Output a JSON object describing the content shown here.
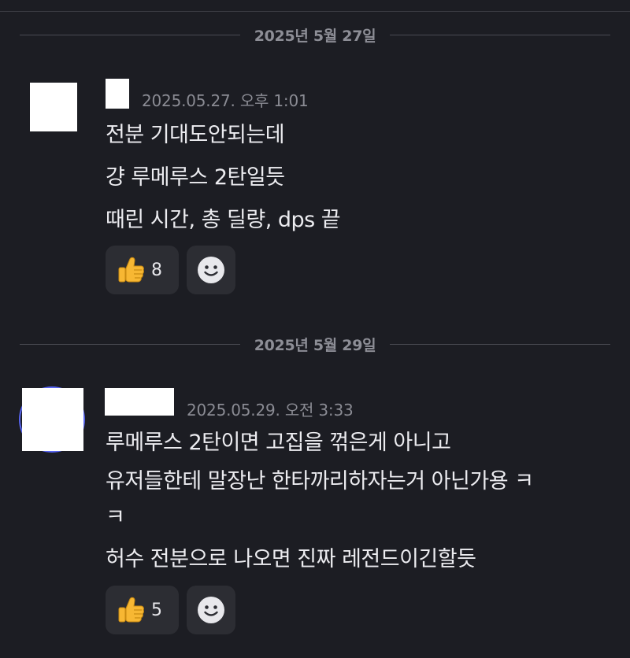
{
  "dividers": [
    {
      "text": "2025년 5월 27일"
    },
    {
      "text": "2025년 5월 29일"
    }
  ],
  "messages": [
    {
      "timestamp": "2025.05.27. 오후 1:01",
      "lines": [
        "전분 기대도안되는데",
        "걍 루메루스 2탄일듯",
        "때린 시간, 총 딜량, dps 끝"
      ],
      "reaction": {
        "icon": "thumbs-up-icon",
        "count": "8"
      }
    },
    {
      "timestamp": "2025.05.29. 오전 3:33",
      "lines": [
        "루메루스 2탄이면 고집을 꺾은게 아니고",
        "유저들한테 말장난 한타까리하자는거 아닌가용 ㅋ",
        "ㅋ",
        "허수 전분으로 나오면 진짜 레전드이긴할듯"
      ],
      "reaction": {
        "icon": "thumbs-up-icon",
        "count": "5"
      }
    }
  ],
  "add_reaction_icon": "smiley-icon",
  "colors": {
    "background": "#1c1d23",
    "reaction_bg": "#2c2d33",
    "timestamp": "#8a8b93",
    "divider_text": "#8d8e96"
  }
}
